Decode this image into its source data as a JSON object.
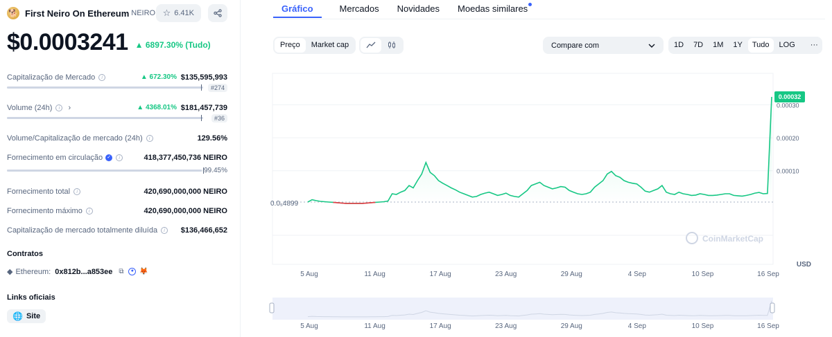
{
  "coin": {
    "name": "First Neiro On Ethereum",
    "symbol": "NEIRO",
    "watchlist_count": "6.41K",
    "price": "$0.0003241",
    "price_change": "6897.30% (Tudo)"
  },
  "stats": {
    "market_cap": {
      "label": "Capitalização de Mercado",
      "change": "672.30%",
      "value": "$135,595,993",
      "rank": "#274"
    },
    "volume": {
      "label": "Volume (24h)",
      "change": "4368.01%",
      "value": "$181,457,739",
      "rank": "#36"
    },
    "vol_mcap": {
      "label": "Volume/Capitalização de mercado (24h)",
      "value": "129.56%"
    },
    "circulating": {
      "label": "Fornecimento em circulação",
      "value": "418,377,450,736 NEIRO",
      "percent": "99.45%",
      "fraction": 0.9945
    },
    "total_supply": {
      "label": "Fornecimento total",
      "value": "420,690,000,000 NEIRO"
    },
    "max_supply": {
      "label": "Fornecimento máximo",
      "value": "420,690,000,000 NEIRO"
    },
    "fdv": {
      "label": "Capitalização de mercado totalmente diluída",
      "value": "$136,466,652"
    }
  },
  "contracts": {
    "title": "Contratos",
    "network": "Ethereum:",
    "address": "0x812b...a853ee"
  },
  "links": {
    "title": "Links oficiais",
    "site": "Site"
  },
  "tabs": [
    "Gráfico",
    "Mercados",
    "Novidades",
    "Moedas similares"
  ],
  "toolbar": {
    "price": "Preço",
    "market_cap": "Market cap",
    "compare": "Compare com",
    "ranges": [
      "1D",
      "7D",
      "1M",
      "1Y",
      "Tudo",
      "LOG"
    ],
    "more": "···"
  },
  "chart_data": {
    "type": "line",
    "currency": "USD",
    "watermark": "CoinMarketCap",
    "x_ticks": [
      "5 Aug",
      "11 Aug",
      "17 Aug",
      "23 Aug",
      "29 Aug",
      "4 Sep",
      "10 Sep",
      "16 Sep"
    ],
    "y_ticks": [
      "0.00030",
      "0.00020",
      "0.00010"
    ],
    "y_tick_values": [
      0.0003,
      0.0002,
      0.0001
    ],
    "ylim": [
      0,
      0.00037
    ],
    "start_label": "0.0₅4899",
    "start_value": 4.899e-06,
    "current_label": "0.00032",
    "current_value": 0.000324,
    "colors": {
      "up": "#16c784",
      "down": "#ea3943"
    },
    "series": [
      {
        "values": [
          4.9e-06,
          1.2e-05,
          9e-06,
          7e-06,
          6e-06,
          5e-06,
          4e-06,
          3e-06,
          2e-06,
          1e-06,
          1e-06,
          1e-06,
          1e-06,
          1e-06,
          2e-06,
          3e-06,
          4e-06,
          5e-06,
          6e-06,
          8e-06,
          3e-05,
          2.8e-05,
          3.5e-05,
          4e-05,
          5.5e-05,
          4.8e-05,
          7e-05,
          9e-05,
          0.000125,
          9.5e-05,
          8.5e-05,
          7e-05,
          6.2e-05,
          5.5e-05,
          4.8e-05,
          4.2e-05,
          3.5e-05,
          3e-05,
          2.5e-05,
          2e-05,
          2.2e-05,
          2.8e-05,
          3.2e-05,
          3.5e-05,
          3e-05,
          2.5e-05,
          2.8e-05,
          3.2e-05,
          2.5e-05,
          2.2e-05,
          2e-05,
          3e-05,
          4e-05,
          5.5e-05,
          6e-05,
          6.5e-05,
          5.5e-05,
          5e-05,
          4.5e-05,
          4.8e-05,
          5.2e-05,
          5e-05,
          4e-05,
          3.5e-05,
          3e-05,
          2.8e-05,
          3e-05,
          3.5e-05,
          5e-05,
          6e-05,
          7e-05,
          9e-05,
          9.8e-05,
          8.5e-05,
          8e-05,
          7e-05,
          6.5e-05,
          6.2e-05,
          6e-05,
          5e-05,
          3.8e-05,
          3.5e-05,
          4e-05,
          4.5e-05,
          5.5e-05,
          3.5e-05,
          3e-05,
          2.8e-05,
          3.5e-05,
          3e-05,
          2.8e-05,
          2.5e-05,
          2.6e-05,
          3e-05,
          2.8e-05,
          2.5e-05,
          2.5e-05,
          2.6e-05,
          2.8e-05,
          3e-05,
          3e-05,
          2.5e-05,
          2.4e-05,
          2.3e-05,
          2.5e-05,
          2.8e-05,
          3.2e-05,
          3.4e-05,
          3e-05,
          3.1e-05,
          0.000324
        ]
      }
    ]
  }
}
